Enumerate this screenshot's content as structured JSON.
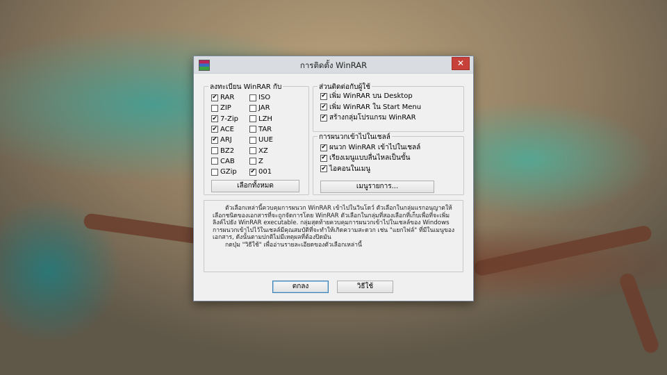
{
  "window": {
    "title": "การติดตั้ง WinRAR",
    "close_label": "✕",
    "icon": "winrar-app-icon"
  },
  "associate": {
    "legend": "ลงทะเบียน WinRAR กับ",
    "col1": [
      {
        "label": "RAR",
        "checked": true
      },
      {
        "label": "ZIP",
        "checked": false
      },
      {
        "label": "7-Zip",
        "checked": true
      },
      {
        "label": "ACE",
        "checked": true
      },
      {
        "label": "ARJ",
        "checked": true
      },
      {
        "label": "BZ2",
        "checked": false
      },
      {
        "label": "CAB",
        "checked": false
      },
      {
        "label": "GZip",
        "checked": false
      }
    ],
    "col2": [
      {
        "label": "ISO",
        "checked": false
      },
      {
        "label": "JAR",
        "checked": false
      },
      {
        "label": "LZH",
        "checked": false
      },
      {
        "label": "TAR",
        "checked": false
      },
      {
        "label": "UUE",
        "checked": false
      },
      {
        "label": "XZ",
        "checked": false
      },
      {
        "label": "Z",
        "checked": false
      },
      {
        "label": "001",
        "checked": true
      }
    ],
    "select_all_label": "เลือกทั้งหมด"
  },
  "interface": {
    "legend": "ส่วนติดต่อกับผู้ใช้",
    "items": [
      {
        "label": "เพิ่ม WinRAR บน Desktop",
        "checked": true
      },
      {
        "label": "เพิ่ม WinRAR ใน Start Menu",
        "checked": true
      },
      {
        "label": "สร้างกลุ่มโปรแกรม WinRAR",
        "checked": true
      }
    ]
  },
  "shell": {
    "legend": "การผนวกเข้าไปในเชลล์",
    "items": [
      {
        "label": "ผนวก WinRAR เข้าไปในเชลล์",
        "checked": true
      },
      {
        "label": "เรียงเมนูแบบลื่นไหลเป็นขั้น",
        "checked": true
      },
      {
        "label": "ไอคอนในเมนู",
        "checked": true
      }
    ],
    "menu_items_label": "เมนูรายการ..."
  },
  "description": {
    "paragraph1": "ตัวเลือกเหล่านี้ควบคุมการผนวก WinRAR เข้าไปในวินโดว์ ตัวเลือกในกลุ่มแรกอนุญาตให้เลือกชนิดของเอกสารที่จะถูกจัดการโดย WinRAR ตัวเลือกในกลุ่มที่สองเลือกที่เก็บเพื่อที่จะเพิ่มลิงค์ไปยัง WinRAR executable. กลุ่มสุดท้ายควบคุมการผนวกเข้าไปในเชลล์ของ Windows การผนวกเข้าไปไว้ในเชลล์มีคุณสมบัติที่จะทำให้เกิดความสะดวก เช่น \"แยกไฟล์\" ที่มีในเมนูของเอกสาร, ดังนั้นตามปกติไม่มีเหตุผลที่ต้องปิดมัน",
    "paragraph2": "กดปุ่ม \"วิธีใช้\" เพื่ออ่านรายละเอียดของตัวเลือกเหล่านี้"
  },
  "buttons": {
    "ok_label": "ตกลง",
    "help_label": "วิธีใช้"
  }
}
